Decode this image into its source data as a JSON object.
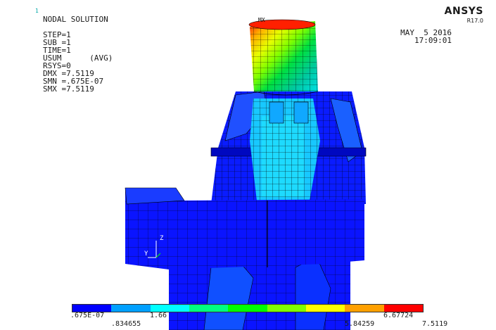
{
  "header": {
    "corner_mark": "1",
    "info_lines": [
      "NODAL SOLUTION",
      "",
      "STEP=1",
      "SUB =1",
      "TIME=1",
      "USUM      (AVG)",
      "RSYS=0",
      "DMX =7.5119",
      "SMN =.675E-07",
      "SMX =7.5119"
    ],
    "date": "MAY  5 2016",
    "time": "17:09:01"
  },
  "brand": {
    "name": "ANSYS",
    "release": "R17.0"
  },
  "model": {
    "max_marker": "MX",
    "triad": {
      "y_axis": "Y",
      "z_axis": "Z"
    }
  },
  "legend": {
    "colors": [
      "#0000ff",
      "#00a0ff",
      "#00ffff",
      "#00ff80",
      "#00ff00",
      "#80ff00",
      "#ffff00",
      "#ffa000",
      "#ff0000"
    ],
    "labels_top": [
      ".675E-07",
      "1.66",
      "",
      "",
      "",
      "6.67724"
    ],
    "labels_bottom": [
      ".834655",
      "",
      "",
      "5.84259",
      "7.5119"
    ]
  }
}
